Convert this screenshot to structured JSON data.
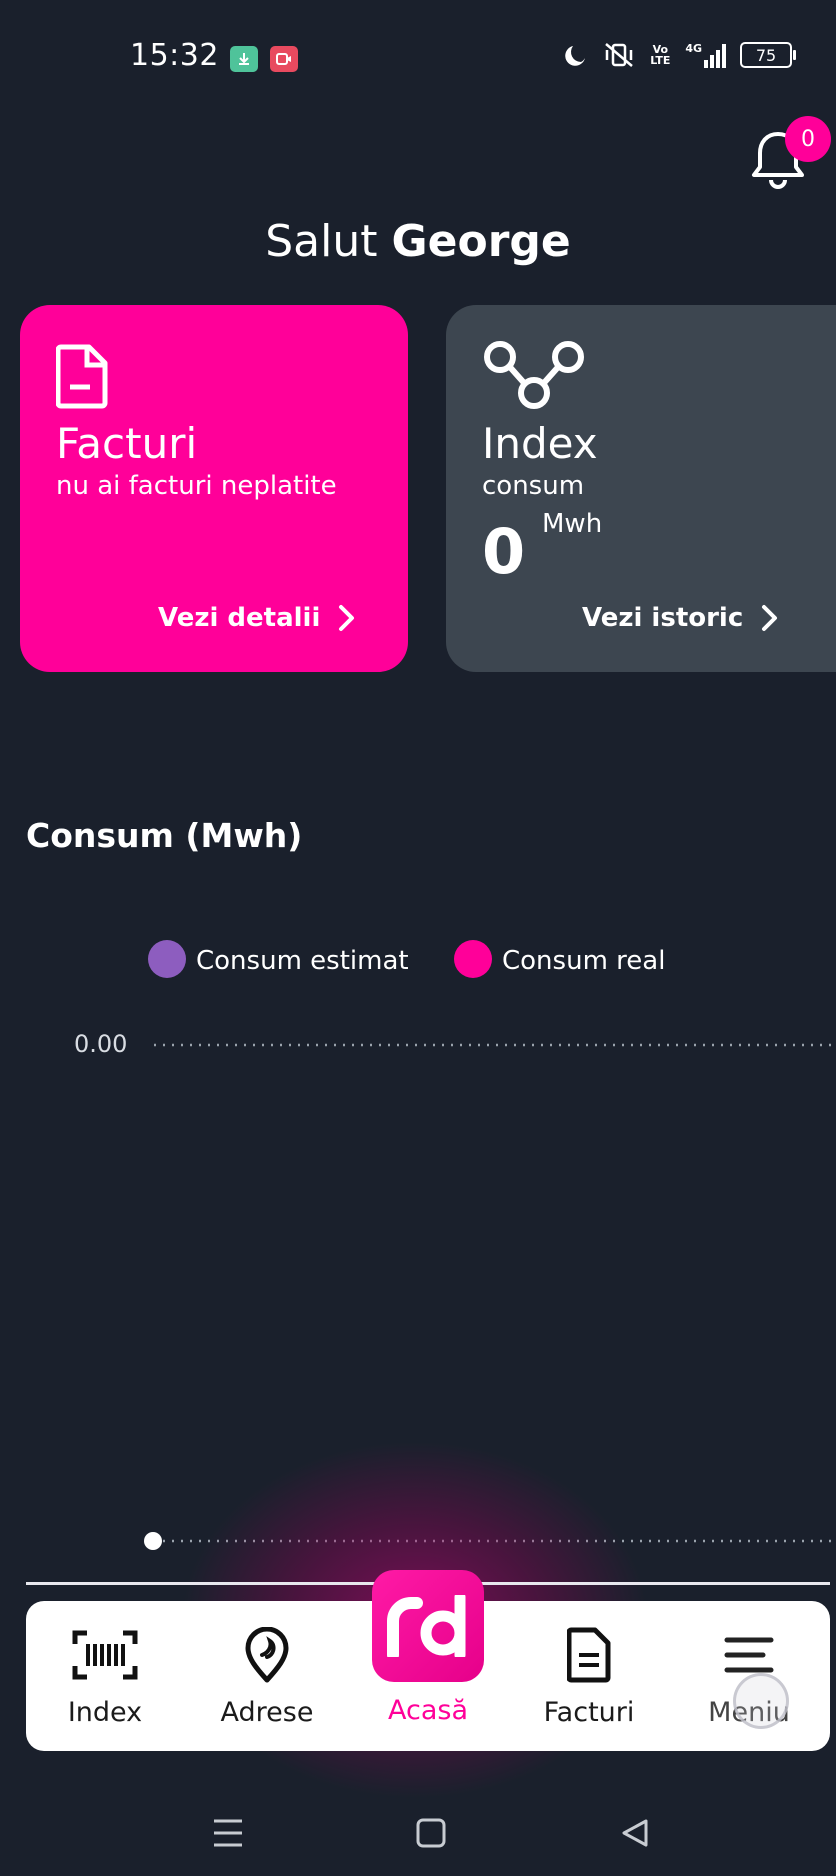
{
  "status_bar": {
    "time": "15:32",
    "battery": "75",
    "network": "4G",
    "volte": "Vo LTE",
    "icons": [
      "download-icon",
      "screen-record-icon",
      "moon-icon",
      "vibrate-off-icon",
      "signal-icon",
      "battery-icon"
    ]
  },
  "notifications": {
    "count": "0",
    "icon": "bell-icon"
  },
  "greeting": {
    "prefix": "Salut",
    "name": "George"
  },
  "cards": {
    "facturi": {
      "title": "Facturi",
      "subtitle": "nu ai facturi neplatite",
      "link": "Vezi detalii",
      "icon": "document-icon",
      "color": "#ff0099"
    },
    "index": {
      "title": "Index",
      "subtitle": "consum",
      "value": "0",
      "unit": "Mwh",
      "link": "Vezi istoric",
      "icon": "nodes-icon",
      "color": "#3d4650"
    }
  },
  "chart": {
    "title": "Consum (Mwh)",
    "legend": [
      {
        "label": "Consum estimat",
        "color": "#8d5dbf"
      },
      {
        "label": "Consum real",
        "color": "#ff0099"
      }
    ]
  },
  "chart_data": {
    "type": "line",
    "title": "Consum (Mwh)",
    "xlabel": "",
    "ylabel": "",
    "y_ticks": [
      "0.00"
    ],
    "series": [
      {
        "name": "Consum estimat",
        "color": "#8d5dbf",
        "values": []
      },
      {
        "name": "Consum real",
        "color": "#ff0099",
        "values": []
      }
    ],
    "grid": true,
    "legend_position": "top"
  },
  "bottom_nav": {
    "items": [
      {
        "label": "Index",
        "icon": "barcode-icon"
      },
      {
        "label": "Adrese",
        "icon": "location-pin-icon"
      },
      {
        "label": "Acasă",
        "icon": "rd-logo-icon",
        "active": true
      },
      {
        "label": "Facturi",
        "icon": "document-icon"
      },
      {
        "label": "Meniu",
        "icon": "menu-icon"
      }
    ],
    "active_color": "#ff0099"
  },
  "system_nav": [
    "recent-apps-icon",
    "home-icon",
    "back-icon"
  ]
}
